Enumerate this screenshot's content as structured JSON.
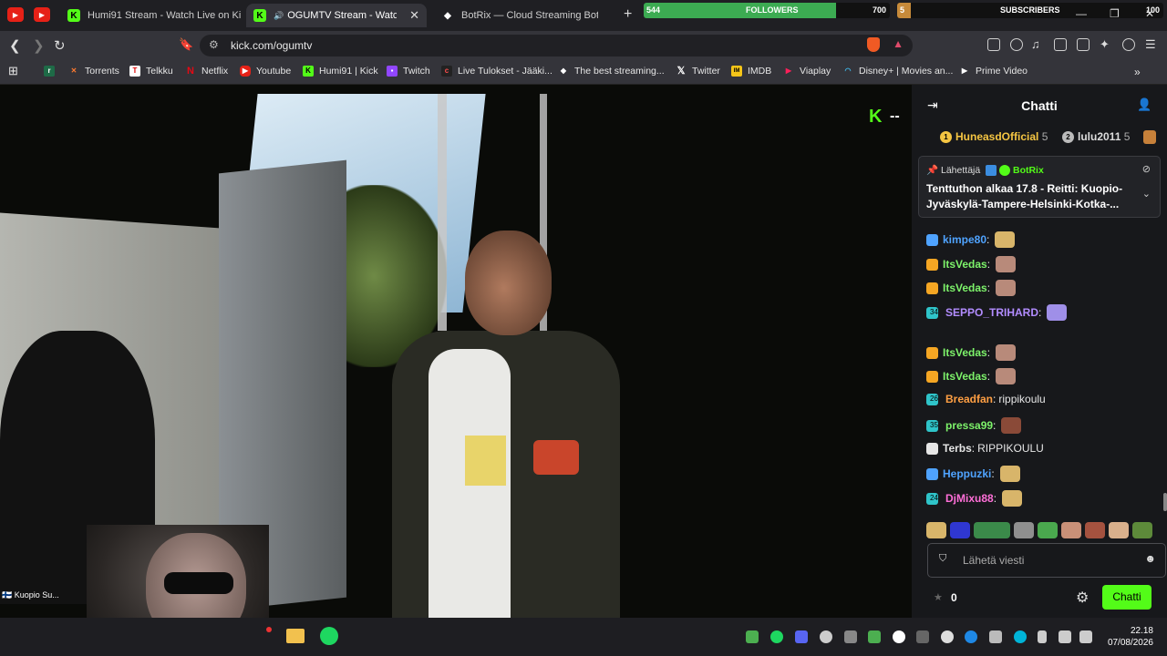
{
  "tabs": [
    {
      "title": "Humi91 Stream - Watch Live on Kick"
    },
    {
      "title": "OGUMTV Stream - Watch Live on Kick"
    },
    {
      "title": "BotRix — Cloud Streaming Bot for Twitch"
    }
  ],
  "overlay": {
    "followers_label": "FOLLOWERS",
    "followers_current": "544",
    "followers_goal": "700",
    "followers_progress": 0.78,
    "subscribers_label": "SUBSCRIBERS",
    "subscribers_current": "5",
    "subscribers_goal": "100",
    "subscribers_progress": 0.05
  },
  "address": {
    "url": "kick.com/ogumtv"
  },
  "bookmarks": [
    {
      "label": "Torrents",
      "icon": "torrent-icon"
    },
    {
      "label": "Telkku",
      "icon": "telkku-icon"
    },
    {
      "label": "Netflix",
      "icon": "netflix-icon"
    },
    {
      "label": "Youtube",
      "icon": "youtube-icon"
    },
    {
      "label": "Humi91 | Kick",
      "icon": "kick-icon"
    },
    {
      "label": "Twitch",
      "icon": "twitch-icon"
    },
    {
      "label": "Live Tulokset - Jääki...",
      "icon": "livescore-icon"
    },
    {
      "label": "The best streaming...",
      "icon": "botrix-icon"
    },
    {
      "label": "Twitter",
      "icon": "x-icon"
    },
    {
      "label": "IMDB",
      "icon": "imdb-icon"
    },
    {
      "label": "Viaplay",
      "icon": "viaplay-icon"
    },
    {
      "label": "Disney+ | Movies an...",
      "icon": "disney-icon"
    },
    {
      "label": "Prime Video",
      "icon": "prime-icon"
    }
  ],
  "video": {
    "cam_caption": "Kuopio Su..."
  },
  "chat": {
    "title": "Chatti",
    "leaderboard": [
      {
        "rank": "1",
        "name": "HuneasdOfficial",
        "count": "5"
      },
      {
        "rank": "2",
        "name": "lulu2011",
        "count": "5"
      }
    ],
    "pinned": {
      "by_label": "Lähettäjä",
      "author": "BotRix",
      "message": "Tenttuthon alkaa 17.8 - Reitti: Kuopio-Jyväskylä-Tampere-Helsinki-Kotka-..."
    },
    "messages": [
      {
        "user": "kimpe80",
        "text": "",
        "color": "#4fa3ff"
      },
      {
        "user": "ItsVedas",
        "text": "",
        "color": "#7df26a"
      },
      {
        "user": "ItsVedas",
        "text": "",
        "color": "#7df26a"
      },
      {
        "user": "SEPPO_TRIHARD",
        "text": "",
        "color": "#b28cff",
        "badge": "34"
      },
      {
        "user": "ItsVedas",
        "text": "",
        "color": "#7df26a"
      },
      {
        "user": "ItsVedas",
        "text": "",
        "color": "#7df26a"
      },
      {
        "user": "Breadfan",
        "text": "rippikoulu",
        "color": "#ff9f43",
        "badge": "26"
      },
      {
        "user": "pressa99",
        "text": "",
        "color": "#7df26a",
        "badge": "35"
      },
      {
        "user": "Terbs",
        "text": "RIPPIKOULU",
        "color": "#e6e6e6"
      },
      {
        "user": "Heppuzki",
        "text": "",
        "color": "#4fa3ff"
      },
      {
        "user": "DjMixu88",
        "text": "",
        "color": "#ff6fd8",
        "badge": "24"
      }
    ],
    "input_placeholder": "Lähetä viesti",
    "points": "0",
    "send_label": "Chatti"
  },
  "taskbar": {
    "time": "22.18",
    "date": "07/08/2026"
  },
  "colors": {
    "kick_green": "#53fc18",
    "chat_bg": "#17181b",
    "browser_bg": "#34343a"
  }
}
